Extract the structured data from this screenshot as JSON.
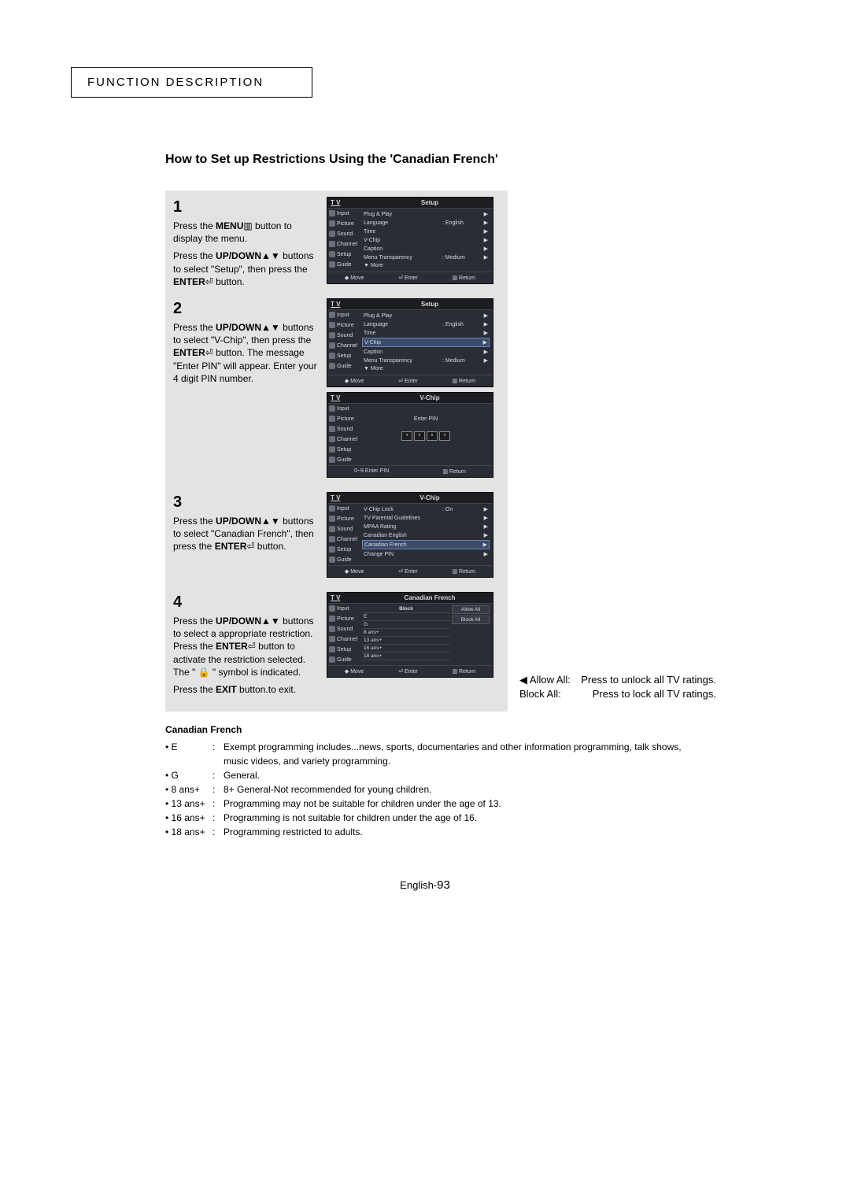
{
  "header": "FUNCTION DESCRIPTION",
  "title": "How to Set up Restrictions Using the 'Canadian French'",
  "sidebar_items": [
    "Input",
    "Picture",
    "Sound",
    "Channel",
    "Setup",
    "Guide"
  ],
  "tv_label": "T V",
  "glyphs": {
    "menu": "▥",
    "updown": "▲▼",
    "enter": "⏎",
    "lock": "🔒",
    "lt": "◀"
  },
  "steps": [
    {
      "num": "1",
      "segments": [
        {
          "t": "Press the "
        },
        {
          "t": "MENU",
          "b": true
        },
        {
          "t": " ",
          "g": "menu"
        },
        {
          "t": " button to display the menu."
        }
      ],
      "segments2": [
        {
          "t": "Press the "
        },
        {
          "t": "UP/DOWN",
          "b": true
        },
        {
          "t": " ",
          "g": "updown"
        },
        {
          "t": " buttons to select \"Setup\", then press the "
        },
        {
          "t": "ENTER",
          "b": true
        },
        {
          "t": " ",
          "g": "enter"
        },
        {
          "t": " button."
        }
      ],
      "shots": [
        {
          "title": "Setup",
          "rows": [
            {
              "lbl": "Plug & Play",
              "val": "",
              "arr": "▶"
            },
            {
              "lbl": "Language",
              "val": ": English",
              "arr": "▶"
            },
            {
              "lbl": "Time",
              "val": "",
              "arr": "▶"
            },
            {
              "lbl": "V-Chip",
              "val": "",
              "arr": "▶"
            },
            {
              "lbl": "Caption",
              "val": "",
              "arr": "▶"
            },
            {
              "lbl": "Menu Transparency",
              "val": ": Medium",
              "arr": "▶"
            },
            {
              "lbl": "▼ More",
              "val": "",
              "arr": ""
            }
          ],
          "foot": [
            "◆ Move",
            "⏎ Enter",
            "▥ Return"
          ]
        }
      ]
    },
    {
      "num": "2",
      "segments": [
        {
          "t": "Press the "
        },
        {
          "t": "UP/DOWN",
          "b": true
        },
        {
          "t": " ",
          "g": "updown"
        },
        {
          "t": " buttons to select \"V-Chip\", then press the "
        },
        {
          "t": "ENTER",
          "b": true
        },
        {
          "t": " ",
          "g": "enter"
        },
        {
          "t": " button. The message \"Enter PIN\" will appear. Enter your 4 digit PIN number."
        }
      ],
      "shots": [
        {
          "title": "Setup",
          "hi": 3,
          "rows": [
            {
              "lbl": "Plug & Play",
              "val": "",
              "arr": "▶"
            },
            {
              "lbl": "Language",
              "val": ": English",
              "arr": "▶"
            },
            {
              "lbl": "Time",
              "val": "",
              "arr": "▶"
            },
            {
              "lbl": "V-Chip",
              "val": "",
              "arr": "▶"
            },
            {
              "lbl": "Caption",
              "val": "",
              "arr": "▶"
            },
            {
              "lbl": "Menu Transparency",
              "val": ": Medium",
              "arr": "▶"
            },
            {
              "lbl": "▼ More",
              "val": "",
              "arr": ""
            }
          ],
          "foot": [
            "◆ Move",
            "⏎ Enter",
            "▥ Return"
          ]
        },
        {
          "title": "V-Chip",
          "pin": true,
          "pin_label": "Enter PIN",
          "foot": [
            "0~9 Enter PIN",
            "▥ Return"
          ]
        }
      ]
    },
    {
      "num": "3",
      "segments": [
        {
          "t": "Press the "
        },
        {
          "t": "UP/DOWN",
          "b": true
        },
        {
          "t": " ",
          "g": "updown"
        },
        {
          "t": " buttons to select \"Canadian French\", then press the "
        },
        {
          "t": "ENTER",
          "b": true
        },
        {
          "t": " ",
          "g": "enter"
        },
        {
          "t": " button."
        }
      ],
      "shots": [
        {
          "title": "V-Chip",
          "hi": 4,
          "rows": [
            {
              "lbl": "V-Chip Lock",
              "val": ": On",
              "arr": "▶"
            },
            {
              "lbl": "TV Parental Guidelines",
              "val": "",
              "arr": "▶"
            },
            {
              "lbl": "MPAA Rating",
              "val": "",
              "arr": "▶"
            },
            {
              "lbl": "Canadian English",
              "val": "",
              "arr": "▶"
            },
            {
              "lbl": "Canadian French",
              "val": "",
              "arr": "▶"
            },
            {
              "lbl": "Change PIN",
              "val": "",
              "arr": "▶"
            }
          ],
          "foot": [
            "◆ Move",
            "⏎ Enter",
            "▥ Return"
          ]
        }
      ]
    },
    {
      "num": "4",
      "segments": [
        {
          "t": "Press the "
        },
        {
          "t": "UP/DOWN",
          "b": true
        },
        {
          "t": " ",
          "g": "updown"
        },
        {
          "t": " buttons  to select a appropriate restriction. Press the "
        },
        {
          "t": "ENTER",
          "b": true
        },
        {
          "t": " ",
          "g": "enter"
        },
        {
          "t": " button to activate the restriction selected. The \" "
        },
        {
          "g": "lock"
        },
        {
          "t": " \" symbol is indicated."
        }
      ],
      "segments2": [
        {
          "t": "Press the "
        },
        {
          "t": "EXIT",
          "b": true
        },
        {
          "t": " button.to exit."
        }
      ],
      "shots": [
        {
          "title": "Canadian French",
          "ratings": true,
          "rating_hdr": "Block",
          "rating_rows": [
            "E",
            "G",
            "8   ans+",
            "13 ans+",
            "16 ans+",
            "18 ans+"
          ],
          "allow": "Allow All",
          "block": "Block All",
          "foot": [
            "◆ Move",
            "⏎ Enter",
            "▥ Return"
          ]
        }
      ]
    }
  ],
  "aside": {
    "arrow": "◀",
    "rows": [
      {
        "label": "Allow All:",
        "desc": "Press to unlock all TV ratings."
      },
      {
        "label": "Block All:",
        "desc": "Press to lock all TV ratings."
      }
    ]
  },
  "definitions": {
    "hdr": "Canadian French",
    "rows": [
      {
        "k": "E",
        "v": "Exempt programming includes...news, sports, documentaries and other information programming, talk shows, music videos, and variety programming."
      },
      {
        "k": "G",
        "v": "General."
      },
      {
        "k": "8 ans+",
        "v": "8+ General-Not recommended for young children."
      },
      {
        "k": "13 ans+",
        "v": "Programming may not be suitable for children under the age of 13."
      },
      {
        "k": "16 ans+",
        "v": "Programming is not suitable for children under the age of 16."
      },
      {
        "k": "18 ans+",
        "v": "Programming restricted to adults."
      }
    ]
  },
  "page_label": "English-",
  "page_number": "93"
}
